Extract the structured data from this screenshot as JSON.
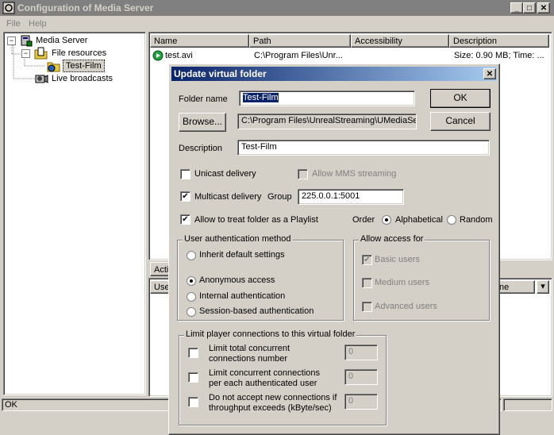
{
  "window": {
    "title": "Configuration of Media Server"
  },
  "menu": [
    "File",
    "Help"
  ],
  "tree": {
    "root": "Media Server",
    "file_resources": "File resources",
    "child": "Test-Film",
    "live": "Live broadcasts"
  },
  "list": {
    "columns": [
      "Name",
      "Path",
      "Accessibility",
      "Description"
    ],
    "rows": [
      {
        "name": "test.avi",
        "path": "C:\\Program Files\\Unr...",
        "access": "",
        "desc": "Size: 0.90 MB; Time: ..."
      }
    ]
  },
  "lower_pane": {
    "tab": "Acti",
    "col1": "Use",
    "col_right": "ne"
  },
  "status": {
    "text": "OK"
  },
  "dialog": {
    "title": "Update virtual folder",
    "folder_name_label": "Folder name",
    "folder_name_value": "Test-Film",
    "browse_label": "Browse...",
    "path_value": "C:\\Program Files\\UnrealStreaming\\UMediaSer",
    "description_label": "Description",
    "description_value": "Test-Film",
    "ok_label": "OK",
    "cancel_label": "Cancel",
    "unicast_label": "Unicast delivery",
    "allow_mms_label": "Allow MMS streaming",
    "multicast_label": "Multicast delivery",
    "group_label": "Group",
    "group_value": "225.0.0.1:5001",
    "playlist_label": "Allow to treat folder as a Playlist",
    "order_label": "Order",
    "alphabetical_label": "Alphabetical",
    "random_label": "Random",
    "auth_group_label": "User authentication method",
    "auth_inherit": "Inherit default settings",
    "auth_anonymous": "Anonymous access",
    "auth_internal": "Internal authentication",
    "auth_session": "Session-based authentication",
    "access_group_label": "Allow access for",
    "access_basic": "Basic users",
    "access_medium": "Medium users",
    "access_advanced": "Advanced users",
    "limit_group_label": "Limit player connections to this virtual folder",
    "limit_total_line1": "Limit total concurrent",
    "limit_total_line2": "connections number",
    "limit_total_value": "0",
    "limit_per_line1": "Limit concurrent connections",
    "limit_per_line2": "per each authenticated user",
    "limit_per_value": "0",
    "limit_throughput_line1": "Do not accept new connections if",
    "limit_throughput_line2": "throughput exceeds (kByte/sec)",
    "limit_throughput_value": "0",
    "state": {
      "unicast": false,
      "allow_mms": false,
      "multicast": true,
      "playlist": true,
      "order": "Alphabetical",
      "auth": "Anonymous access",
      "basic": true,
      "medium": false,
      "advanced": false,
      "limit_total": false,
      "limit_per": false,
      "limit_throughput": false
    }
  }
}
